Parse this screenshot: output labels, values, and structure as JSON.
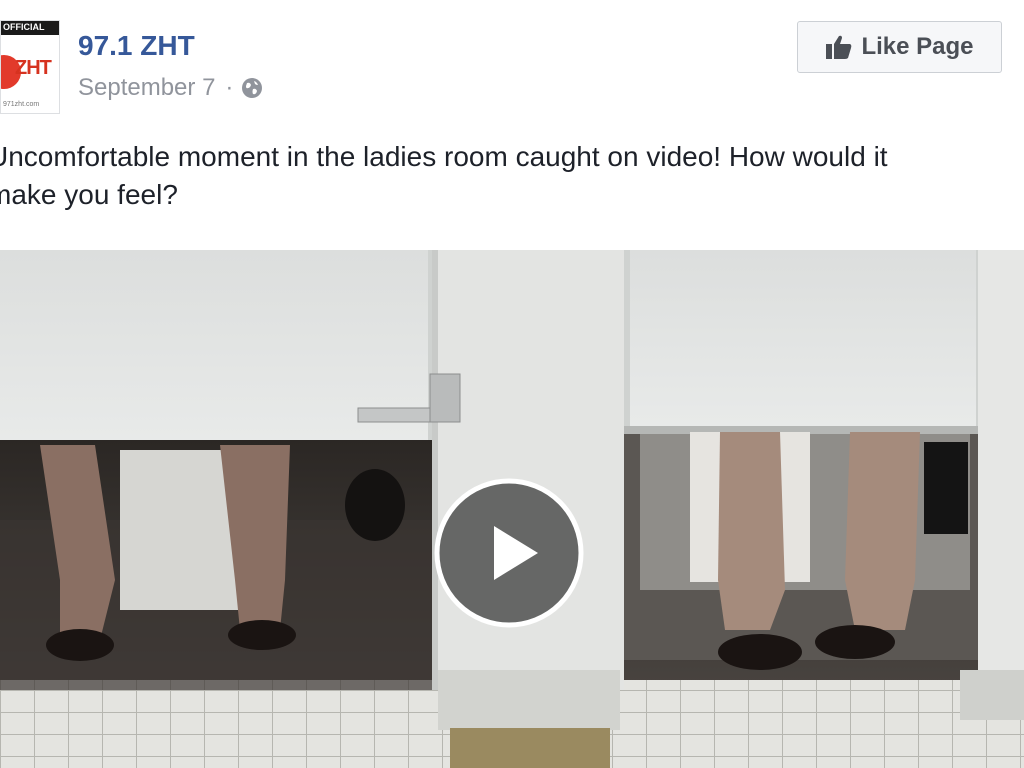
{
  "page": {
    "name": "97.1 ZHT",
    "date": "September 7",
    "separator": "·",
    "audience_icon": "globe-icon"
  },
  "avatar": {
    "banner_text": "OFFICIAL",
    "brand_text": "ZHT",
    "url_text": "971zht.com"
  },
  "actions": {
    "like_page_label": "Like Page",
    "like_icon": "thumbs-up-icon"
  },
  "post": {
    "text_line_1": "Uncomfortable moment in the ladies room caught on video! How would it",
    "text_line_2": "make you feel?"
  },
  "video": {
    "play_icon": "play-icon"
  },
  "colors": {
    "link_blue": "#365899",
    "meta_gray": "#90949c",
    "text": "#1d2129",
    "button_bg": "#f6f7f9",
    "button_border": "#ccd0d5"
  }
}
